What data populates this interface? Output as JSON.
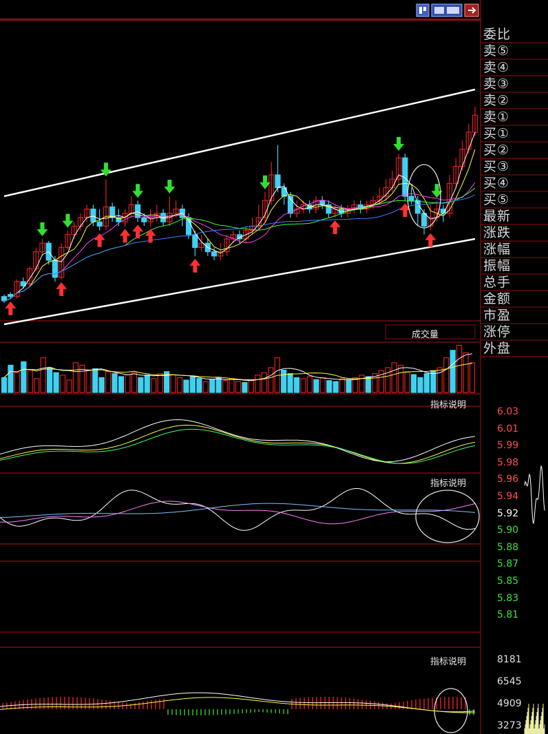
{
  "window": {
    "top_icons": [
      "grid-toggle-icon",
      "layout-icon",
      "exit-icon"
    ]
  },
  "sidebar": {
    "labels": [
      "委比",
      "卖⑤",
      "卖④",
      "卖③",
      "卖②",
      "卖①",
      "买①",
      "买②",
      "买③",
      "买④",
      "买⑤",
      "最新",
      "涨跌",
      "涨幅",
      "振幅",
      "总手",
      "金额",
      "市盈",
      "涨停",
      "外盘"
    ]
  },
  "panels": {
    "volume_title": "成交量",
    "indicator_title_1": "指标说明",
    "indicator_title_2": "指标说明",
    "indicator_title_3": "指标说明"
  },
  "price_axis": {
    "price_ticks": [
      "6.03",
      "6.01",
      "5.99",
      "5.98",
      "5.96",
      "5.94",
      "5.92",
      "5.90",
      "5.88",
      "5.87",
      "5.85",
      "5.83",
      "5.81"
    ],
    "volume_ticks": [
      "8181",
      "6545",
      "4909",
      "3273"
    ],
    "current_price": "5.92"
  },
  "colors": {
    "up": "#e02020",
    "down": "#40d0f0",
    "trendline": "#ffffff",
    "arrow_up": "#ff3030",
    "arrow_down": "#30e030",
    "grid": "#8a1010"
  },
  "chart_data": {
    "type": "candlestick",
    "candles": [
      [
        3,
        1,
        4,
        0
      ],
      [
        4,
        3,
        5,
        2
      ],
      [
        3,
        10,
        11,
        2
      ],
      [
        10,
        8,
        12,
        7
      ],
      [
        9,
        16,
        17,
        8
      ],
      [
        16,
        24,
        26,
        15
      ],
      [
        24,
        28,
        30,
        22
      ],
      [
        28,
        20,
        29,
        18
      ],
      [
        20,
        12,
        22,
        10
      ],
      [
        12,
        26,
        28,
        11
      ],
      [
        26,
        32,
        34,
        25
      ],
      [
        32,
        36,
        38,
        30
      ],
      [
        36,
        40,
        42,
        34
      ],
      [
        40,
        44,
        46,
        38
      ],
      [
        44,
        38,
        46,
        36
      ],
      [
        38,
        36,
        44,
        34
      ],
      [
        36,
        45,
        58,
        34
      ],
      [
        45,
        40,
        47,
        38
      ],
      [
        40,
        38,
        44,
        36
      ],
      [
        38,
        42,
        44,
        36
      ],
      [
        42,
        46,
        50,
        40
      ],
      [
        46,
        40,
        48,
        38
      ],
      [
        40,
        38,
        42,
        36
      ],
      [
        38,
        40,
        44,
        36
      ],
      [
        40,
        42,
        46,
        38
      ],
      [
        42,
        38,
        44,
        36
      ],
      [
        38,
        42,
        50,
        36
      ],
      [
        42,
        44,
        48,
        40
      ],
      [
        44,
        40,
        46,
        36
      ],
      [
        40,
        32,
        42,
        30
      ],
      [
        32,
        26,
        34,
        22
      ],
      [
        26,
        28,
        32,
        24
      ],
      [
        28,
        24,
        30,
        22
      ],
      [
        24,
        22,
        26,
        20
      ],
      [
        22,
        24,
        28,
        20
      ],
      [
        24,
        30,
        32,
        22
      ],
      [
        30,
        32,
        34,
        28
      ],
      [
        32,
        30,
        34,
        28
      ],
      [
        30,
        34,
        36,
        28
      ],
      [
        34,
        36,
        40,
        32
      ],
      [
        36,
        40,
        46,
        34
      ],
      [
        40,
        48,
        52,
        38
      ],
      [
        48,
        60,
        66,
        46
      ],
      [
        60,
        54,
        74,
        52
      ],
      [
        54,
        50,
        56,
        46
      ],
      [
        50,
        42,
        52,
        40
      ],
      [
        42,
        44,
        48,
        40
      ],
      [
        44,
        46,
        48,
        42
      ],
      [
        46,
        44,
        48,
        42
      ],
      [
        44,
        48,
        50,
        42
      ],
      [
        48,
        46,
        50,
        44
      ],
      [
        46,
        42,
        48,
        40
      ],
      [
        42,
        44,
        46,
        40
      ],
      [
        44,
        42,
        46,
        40
      ],
      [
        42,
        44,
        46,
        40
      ],
      [
        44,
        46,
        48,
        42
      ],
      [
        46,
        44,
        48,
        42
      ],
      [
        44,
        46,
        48,
        42
      ],
      [
        46,
        48,
        50,
        44
      ],
      [
        48,
        50,
        54,
        46
      ],
      [
        50,
        54,
        58,
        48
      ],
      [
        54,
        58,
        62,
        52
      ],
      [
        58,
        68,
        70,
        56
      ],
      [
        68,
        50,
        70,
        48
      ],
      [
        50,
        48,
        54,
        46
      ],
      [
        48,
        42,
        50,
        36
      ],
      [
        42,
        36,
        44,
        32
      ],
      [
        36,
        40,
        46,
        34
      ],
      [
        40,
        44,
        48,
        38
      ],
      [
        44,
        42,
        46,
        38
      ],
      [
        42,
        56,
        60,
        40
      ],
      [
        56,
        64,
        68,
        54
      ],
      [
        64,
        72,
        76,
        62
      ],
      [
        72,
        80,
        84,
        70
      ],
      [
        80,
        88,
        92,
        78
      ]
    ],
    "volume": [
      30,
      55,
      40,
      62,
      45,
      28,
      70,
      50,
      40,
      35,
      25,
      60,
      55,
      45,
      48,
      30,
      42,
      38,
      32,
      36,
      40,
      30,
      35,
      28,
      38,
      42,
      36,
      30,
      25,
      32,
      28,
      22,
      26,
      30,
      24,
      28,
      22,
      20,
      25,
      35,
      40,
      50,
      70,
      45,
      38,
      30,
      28,
      32,
      26,
      30,
      24,
      22,
      28,
      26,
      30,
      35,
      32,
      38,
      44,
      50,
      60,
      55,
      42,
      36,
      30,
      38,
      44,
      50,
      70,
      85,
      95,
      80,
      60
    ],
    "trendline_upper": [
      [
        0,
        50
      ],
      [
        74,
        100
      ]
    ],
    "trendline_lower": [
      [
        0,
        -10
      ],
      [
        74,
        30
      ]
    ],
    "buy_arrows": [
      1,
      9,
      15,
      19,
      21,
      23,
      30,
      52,
      63,
      67
    ],
    "sell_arrows": [
      6,
      10,
      16,
      21,
      26,
      41,
      62,
      68
    ]
  }
}
